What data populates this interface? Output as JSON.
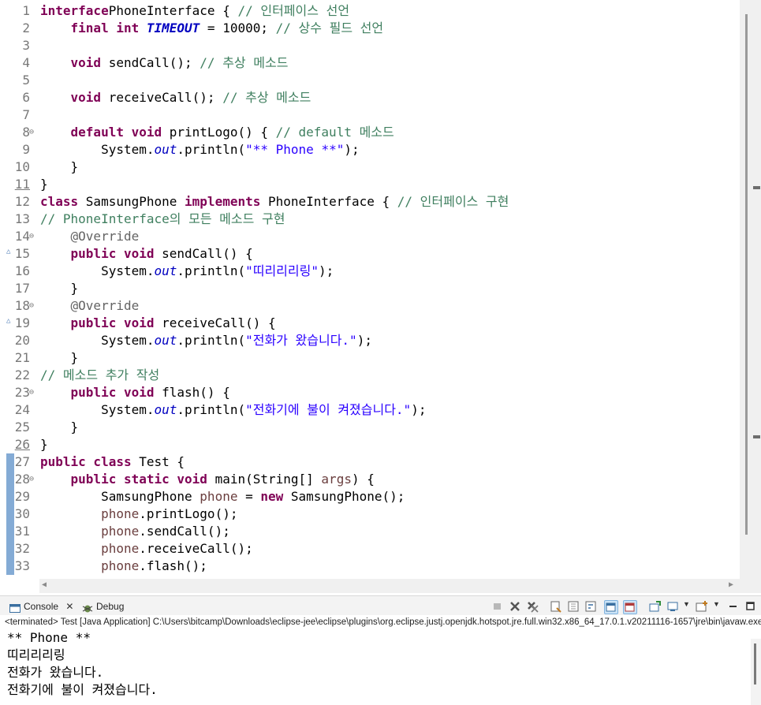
{
  "editor": {
    "lines": [
      {
        "num": "1",
        "tokens": [
          [
            "k",
            "interface"
          ],
          [
            "",
            "PhoneInterface { "
          ],
          [
            "c",
            "// 인터페이스 선언"
          ]
        ]
      },
      {
        "num": "2",
        "tokens": [
          [
            "",
            "    "
          ],
          [
            "k",
            "final int "
          ],
          [
            "f",
            "TIMEOUT"
          ],
          [
            "",
            " = 10000; "
          ],
          [
            "c",
            "// 상수 필드 선언"
          ]
        ]
      },
      {
        "num": "3",
        "tokens": []
      },
      {
        "num": "4",
        "tokens": [
          [
            "",
            "    "
          ],
          [
            "k",
            "void "
          ],
          [
            "",
            "sendCall(); "
          ],
          [
            "c",
            "// 추상 메소드"
          ]
        ]
      },
      {
        "num": "5",
        "tokens": []
      },
      {
        "num": "6",
        "tokens": [
          [
            "",
            "    "
          ],
          [
            "k",
            "void "
          ],
          [
            "",
            "receiveCall(); "
          ],
          [
            "c",
            "// 추상 메소드"
          ]
        ]
      },
      {
        "num": "7",
        "tokens": []
      },
      {
        "num": "8",
        "fold": "⊖",
        "tokens": [
          [
            "",
            "    "
          ],
          [
            "k",
            "default void "
          ],
          [
            "",
            "printLogo() { "
          ],
          [
            "c",
            "// default 메소드"
          ]
        ]
      },
      {
        "num": "9",
        "tokens": [
          [
            "",
            "        System."
          ],
          [
            "fi",
            "out"
          ],
          [
            "",
            ".println("
          ],
          [
            "s",
            "\"** Phone **\""
          ],
          [
            "",
            ");"
          ]
        ]
      },
      {
        "num": "10",
        "tokens": [
          [
            "",
            "    }"
          ]
        ]
      },
      {
        "num": "11",
        "underline": true,
        "tokens": [
          [
            "",
            "}"
          ]
        ]
      },
      {
        "num": "12",
        "tokens": [
          [
            "k",
            "class "
          ],
          [
            "",
            "SamsungPhone "
          ],
          [
            "k",
            "implements "
          ],
          [
            "",
            "PhoneInterface { "
          ],
          [
            "c",
            "// 인터페이스 구현"
          ]
        ]
      },
      {
        "num": "13",
        "tokens": [
          [
            "c",
            "// PhoneInterface의 모든 메소드 구현"
          ]
        ]
      },
      {
        "num": "14",
        "fold": "⊖",
        "tokens": [
          [
            "",
            "    "
          ],
          [
            "a",
            "@Override"
          ]
        ]
      },
      {
        "num": "15",
        "override": true,
        "tokens": [
          [
            "",
            "    "
          ],
          [
            "k",
            "public void "
          ],
          [
            "",
            "sendCall() {"
          ]
        ]
      },
      {
        "num": "16",
        "tokens": [
          [
            "",
            "        System."
          ],
          [
            "fi",
            "out"
          ],
          [
            "",
            ".println("
          ],
          [
            "s",
            "\"띠리리리링\""
          ],
          [
            "",
            ");"
          ]
        ]
      },
      {
        "num": "17",
        "tokens": [
          [
            "",
            "    }"
          ]
        ]
      },
      {
        "num": "18",
        "fold": "⊖",
        "tokens": [
          [
            "",
            "    "
          ],
          [
            "a",
            "@Override"
          ]
        ]
      },
      {
        "num": "19",
        "override": true,
        "tokens": [
          [
            "",
            "    "
          ],
          [
            "k",
            "public void "
          ],
          [
            "",
            "receiveCall() {"
          ]
        ]
      },
      {
        "num": "20",
        "tokens": [
          [
            "",
            "        System."
          ],
          [
            "fi",
            "out"
          ],
          [
            "",
            ".println("
          ],
          [
            "s",
            "\"전화가 왔습니다.\""
          ],
          [
            "",
            ");"
          ]
        ]
      },
      {
        "num": "21",
        "tokens": [
          [
            "",
            "    }"
          ]
        ]
      },
      {
        "num": "22",
        "tokens": [
          [
            "c",
            "// 메소드 추가 작성"
          ]
        ]
      },
      {
        "num": "23",
        "fold": "⊖",
        "tokens": [
          [
            "",
            "    "
          ],
          [
            "k",
            "public void "
          ],
          [
            "",
            "flash() {"
          ]
        ]
      },
      {
        "num": "24",
        "tokens": [
          [
            "",
            "        System."
          ],
          [
            "fi",
            "out"
          ],
          [
            "",
            ".println("
          ],
          [
            "s",
            "\"전화기에 불이 켜졌습니다.\""
          ],
          [
            "",
            ");"
          ]
        ]
      },
      {
        "num": "25",
        "tokens": [
          [
            "",
            "    }"
          ]
        ]
      },
      {
        "num": "26",
        "underline": true,
        "tokens": [
          [
            "",
            "}"
          ]
        ]
      },
      {
        "num": "27",
        "marker": true,
        "tokens": [
          [
            "k",
            "public class "
          ],
          [
            "",
            "Test {"
          ]
        ]
      },
      {
        "num": "28",
        "marker": true,
        "fold": "⊖",
        "tokens": [
          [
            "",
            "    "
          ],
          [
            "k",
            "public static void "
          ],
          [
            "",
            "main(String[] "
          ],
          [
            "v",
            "args"
          ],
          [
            "",
            ") {"
          ]
        ]
      },
      {
        "num": "29",
        "marker": true,
        "tokens": [
          [
            "",
            "        SamsungPhone "
          ],
          [
            "v",
            "phone"
          ],
          [
            "",
            " = "
          ],
          [
            "k",
            "new "
          ],
          [
            "",
            "SamsungPhone();"
          ]
        ]
      },
      {
        "num": "30",
        "marker": true,
        "tokens": [
          [
            "",
            "        "
          ],
          [
            "v",
            "phone"
          ],
          [
            "",
            ".printLogo();"
          ]
        ]
      },
      {
        "num": "31",
        "marker": true,
        "tokens": [
          [
            "",
            "        "
          ],
          [
            "v",
            "phone"
          ],
          [
            "",
            ".sendCall();"
          ]
        ]
      },
      {
        "num": "32",
        "marker": true,
        "tokens": [
          [
            "",
            "        "
          ],
          [
            "v",
            "phone"
          ],
          [
            "",
            ".receiveCall();"
          ]
        ]
      },
      {
        "num": "33",
        "marker": true,
        "tokens": [
          [
            "",
            "        "
          ],
          [
            "v",
            "phone"
          ],
          [
            "",
            ".flash();"
          ]
        ]
      }
    ]
  },
  "panel": {
    "tabs": [
      {
        "label": "Console",
        "icon": "console-icon",
        "active": true
      },
      {
        "label": "Debug",
        "icon": "debug-icon",
        "active": false
      }
    ],
    "close_glyph": "✕",
    "status": "<terminated> Test [Java Application] C:\\Users\\bitcamp\\Downloads\\eclipse-jee\\eclipse\\plugins\\org.eclipse.justj.openjdk.hotspot.jre.full.win32.x86_64_17.0.1.v20211116-1657\\jre\\bin\\javaw.exe"
  },
  "console": {
    "output": [
      "** Phone **",
      "띠리리리링",
      "전화가 왔습니다.",
      "전화기에 불이 켜졌습니다."
    ]
  }
}
